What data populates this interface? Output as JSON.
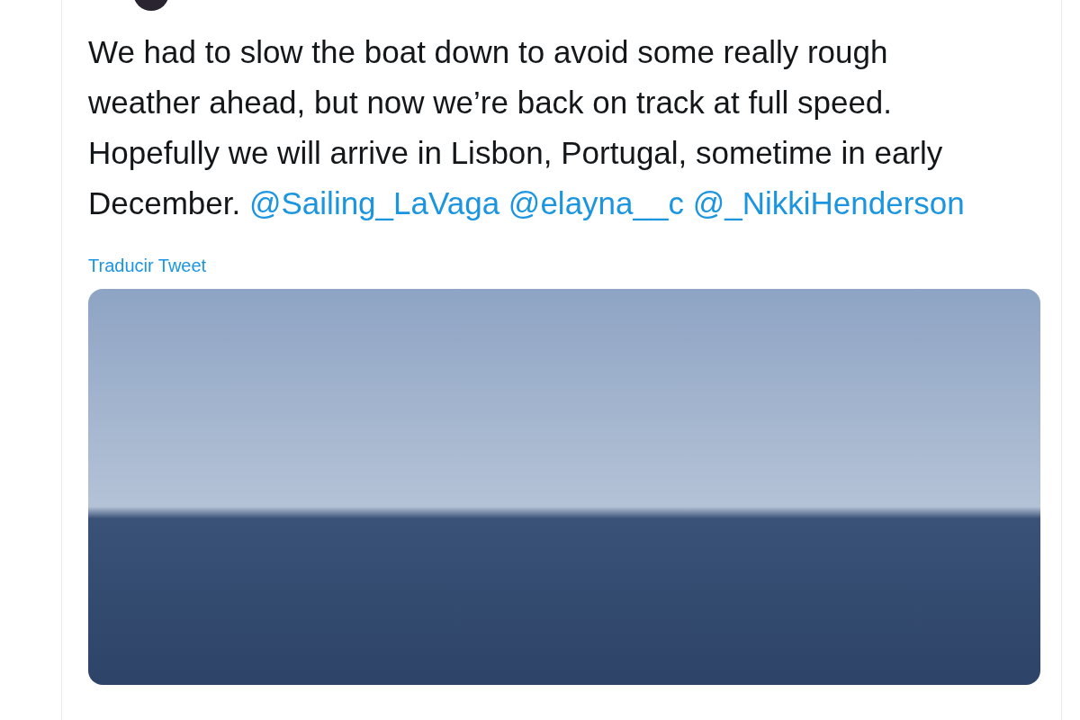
{
  "tweet": {
    "text": [
      {
        "kind": "text",
        "text": "We had to slow the boat down to avoid some really rough weather ahead, but now we’re back on track at full speed. Hopefully we will arrive in Lisbon, Portugal, sometime in early December."
      },
      {
        "kind": "mention",
        "text": "@Sailing_LaVaga"
      },
      {
        "kind": "mention",
        "text": "@elayna__c"
      },
      {
        "kind": "mention",
        "text": "@_NikkiHenderson"
      }
    ],
    "translate_link": "Traducir Tweet"
  }
}
